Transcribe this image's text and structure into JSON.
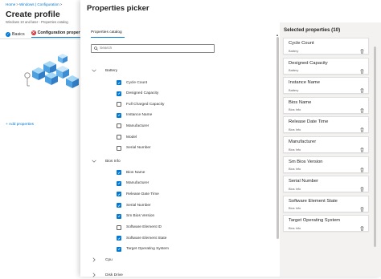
{
  "background": {
    "breadcrumb": [
      "Home",
      "Windows | Configuration"
    ],
    "title": "Create profile",
    "subtitle": "Windows 10 and later - Properties catalog",
    "steps": [
      {
        "label": "Basics",
        "state": "complete"
      },
      {
        "label": "Configuration properties",
        "state": "error"
      }
    ],
    "add_properties": "+ Add properties"
  },
  "picker": {
    "title": "Properties picker",
    "tab": "Properties catalog",
    "search_placeholder": "Search",
    "groups": [
      {
        "name": "Battery",
        "expanded": true,
        "items": [
          {
            "label": "Cycle Count",
            "checked": true
          },
          {
            "label": "Designed Capacity",
            "checked": true
          },
          {
            "label": "Full Charged Capacity",
            "checked": false
          },
          {
            "label": "Instance Name",
            "checked": true
          },
          {
            "label": "Manufacturer",
            "checked": false
          },
          {
            "label": "Model",
            "checked": false
          },
          {
            "label": "Serial Number",
            "checked": false
          }
        ]
      },
      {
        "name": "Bios Info",
        "expanded": true,
        "items": [
          {
            "label": "Bios Name",
            "checked": true
          },
          {
            "label": "Manufacturer",
            "checked": true
          },
          {
            "label": "Release Date Time",
            "checked": true
          },
          {
            "label": "Serial Number",
            "checked": true
          },
          {
            "label": "Sm Bios Version",
            "checked": true
          },
          {
            "label": "Software Element ID",
            "checked": false
          },
          {
            "label": "Software Element State",
            "checked": true
          },
          {
            "label": "Target Operating System",
            "checked": true
          }
        ]
      },
      {
        "name": "Cpu",
        "expanded": false,
        "items": []
      },
      {
        "name": "Disk Drive",
        "expanded": false,
        "items": []
      }
    ]
  },
  "selected": {
    "title": "Selected properties (10)",
    "items": [
      {
        "name": "Cycle Count",
        "group": "Battery"
      },
      {
        "name": "Designed Capacity",
        "group": "Battery"
      },
      {
        "name": "Instance Name",
        "group": "Battery"
      },
      {
        "name": "Bios Name",
        "group": "Bios Info"
      },
      {
        "name": "Release Date Time",
        "group": "Bios Info"
      },
      {
        "name": "Manufacturer",
        "group": "Bios Info"
      },
      {
        "name": "Sm Bios Version",
        "group": "Bios Info"
      },
      {
        "name": "Serial Number",
        "group": "Bios Info"
      },
      {
        "name": "Software Element State",
        "group": "Bios Info"
      },
      {
        "name": "Target Operating System",
        "group": "Bios Info"
      }
    ]
  },
  "colors": {
    "accent": "#0078d4",
    "error": "#d13438",
    "panel_bg": "#f3f2f1"
  },
  "icons": {
    "search": "search-icon",
    "expand": "chevron-down-icon",
    "collapse": "chevron-right-icon",
    "remove": "trash-icon"
  }
}
